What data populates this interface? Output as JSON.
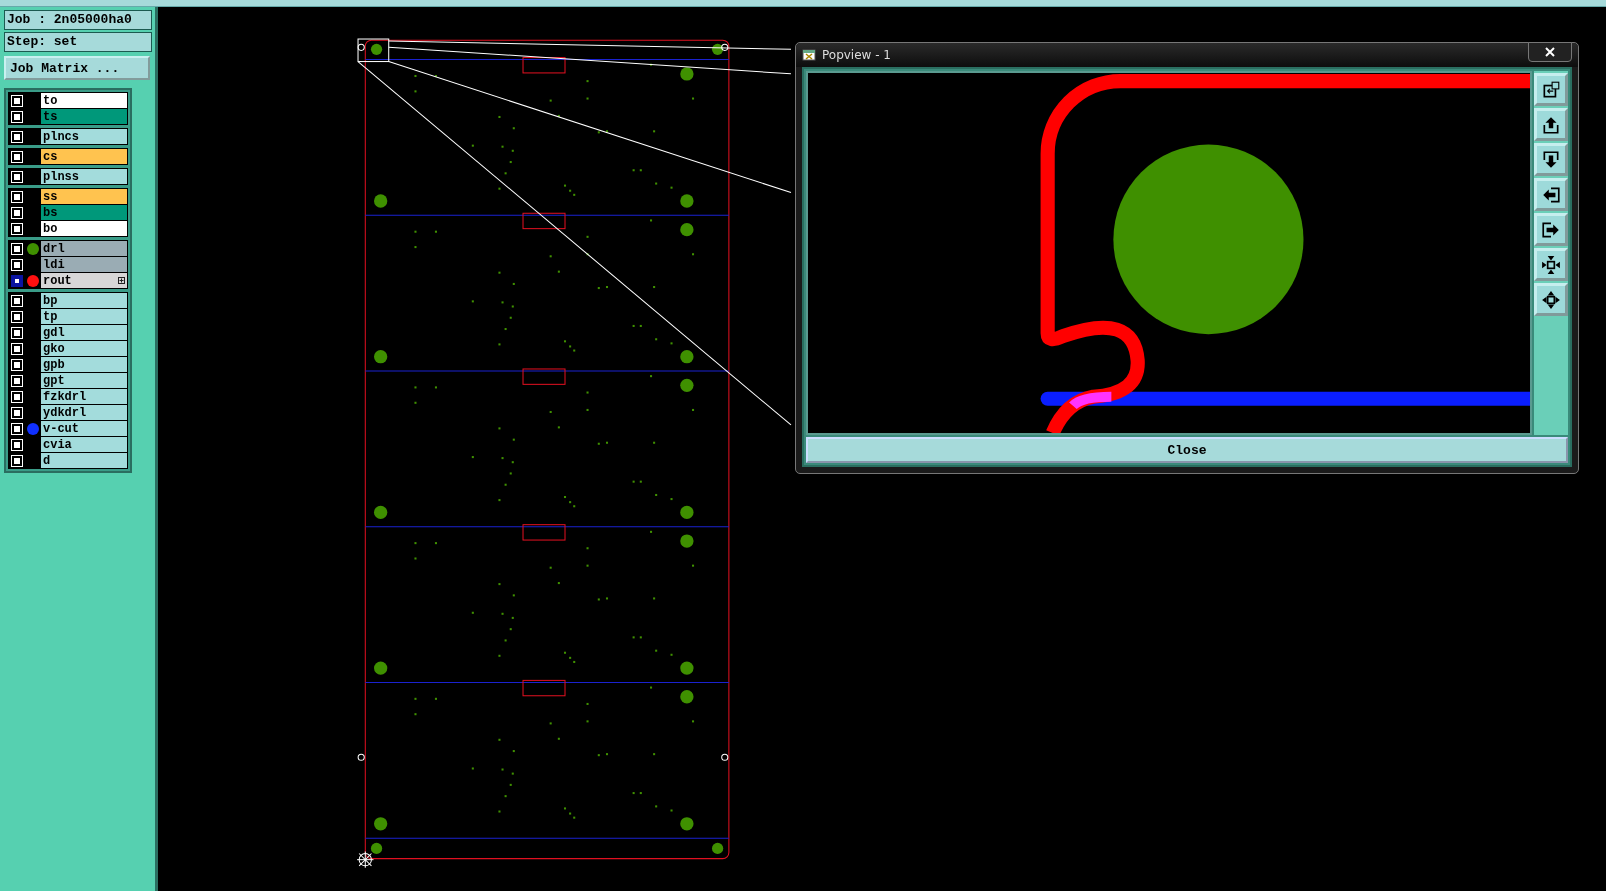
{
  "job": {
    "job_line": "Job : 2n05000ha0",
    "step_line": "Step: set",
    "matrix_button": "Job Matrix ..."
  },
  "layer_groups": [
    {
      "layers": [
        {
          "name": "to",
          "color": "#ffffff",
          "selected": false
        },
        {
          "name": "ts",
          "color": "#00987a",
          "selected": false
        }
      ]
    },
    {
      "layers": [
        {
          "name": "plncs",
          "color": "#a3dcdc",
          "selected": false
        }
      ]
    },
    {
      "layers": [
        {
          "name": "cs",
          "color": "#ffc34f",
          "selected": false
        }
      ]
    },
    {
      "layers": [
        {
          "name": "plnss",
          "color": "#a3dcdc",
          "selected": false
        }
      ]
    },
    {
      "layers": [
        {
          "name": "ss",
          "color": "#ffc34f",
          "selected": false
        },
        {
          "name": "bs",
          "color": "#00987a",
          "selected": false
        },
        {
          "name": "bo",
          "color": "#ffffff",
          "selected": false
        }
      ]
    },
    {
      "layers": [
        {
          "name": "drl",
          "color": "#9aacb4",
          "marker": {
            "color": "#3f9000"
          },
          "selected": false
        },
        {
          "name": "ldi",
          "color": "#9aacb4",
          "selected": false
        },
        {
          "name": "rout",
          "color": "#d7d7d7",
          "marker": {
            "color": "#ff1010"
          },
          "selected": true
        }
      ]
    },
    {
      "layers": [
        {
          "name": "bp",
          "color": "#a3dcdc",
          "selected": false
        },
        {
          "name": "tp",
          "color": "#a3dcdc",
          "selected": false
        },
        {
          "name": "gdl",
          "color": "#a3dcdc",
          "selected": false
        },
        {
          "name": "gko",
          "color": "#a3dcdc",
          "selected": false
        },
        {
          "name": "gpb",
          "color": "#a3dcdc",
          "selected": false
        },
        {
          "name": "gpt",
          "color": "#a3dcdc",
          "selected": false
        },
        {
          "name": "fzkdrl",
          "color": "#a3dcdc",
          "selected": false
        },
        {
          "name": "ydkdrl",
          "color": "#a3dcdc",
          "selected": false
        },
        {
          "name": "v-cut",
          "color": "#a3dcdc",
          "marker": {
            "color": "#1030ff"
          },
          "selected": false
        },
        {
          "name": "cvia",
          "color": "#a3dcdc",
          "selected": false
        },
        {
          "name": "d",
          "color": "#a3dcdc",
          "selected": false
        }
      ]
    }
  ],
  "popview": {
    "title": "Popview - 1",
    "close_button": "Close"
  }
}
